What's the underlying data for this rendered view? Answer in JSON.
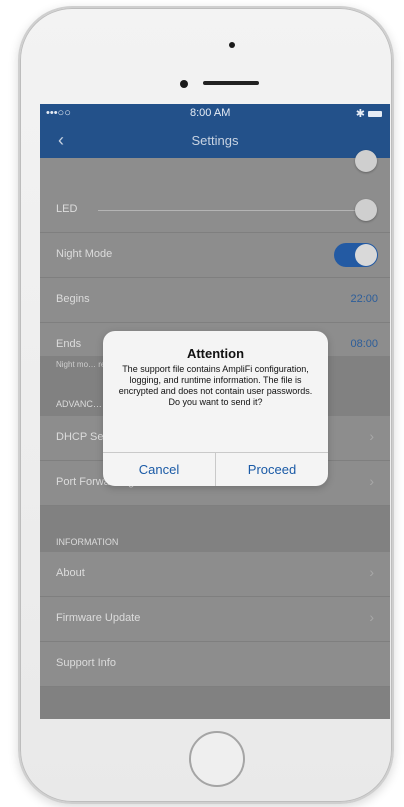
{
  "status_bar": {
    "carrier": "•••○○",
    "time": "8:00 AM",
    "icons": "✱"
  },
  "nav": {
    "back": "‹",
    "title": "Settings"
  },
  "rows": {
    "led": {
      "label": "LED"
    },
    "night_mode": {
      "label": "Night Mode",
      "enabled": true
    },
    "begins": {
      "label": "Begins",
      "value": "22:00"
    },
    "ends": {
      "label": "Ends",
      "value": "08:00"
    },
    "night_note": "Night mo… recomme… from bac… …bance",
    "advanced_header": "ADVANC…",
    "dhcp": {
      "label": "DHCP Se…"
    },
    "port_forwarding": {
      "label": "Port Forwarding"
    },
    "information_header": "INFORMATION",
    "about": {
      "label": "About"
    },
    "firmware_update": {
      "label": "Firmware Update"
    },
    "support_info": {
      "label": "Support Info"
    }
  },
  "dialog": {
    "title": "Attention",
    "message": "The support file contains AmpliFi configuration, logging, and runtime information. The file is encrypted and does not contain user passwords. Do you want to send it?",
    "cancel": "Cancel",
    "proceed": "Proceed"
  },
  "icons": {
    "chevron": "chevron-right-icon",
    "back": "chevron-left-icon"
  },
  "colors": {
    "nav": "#23518a",
    "accent": "#235aa3",
    "dim": "#8d8d8d"
  }
}
